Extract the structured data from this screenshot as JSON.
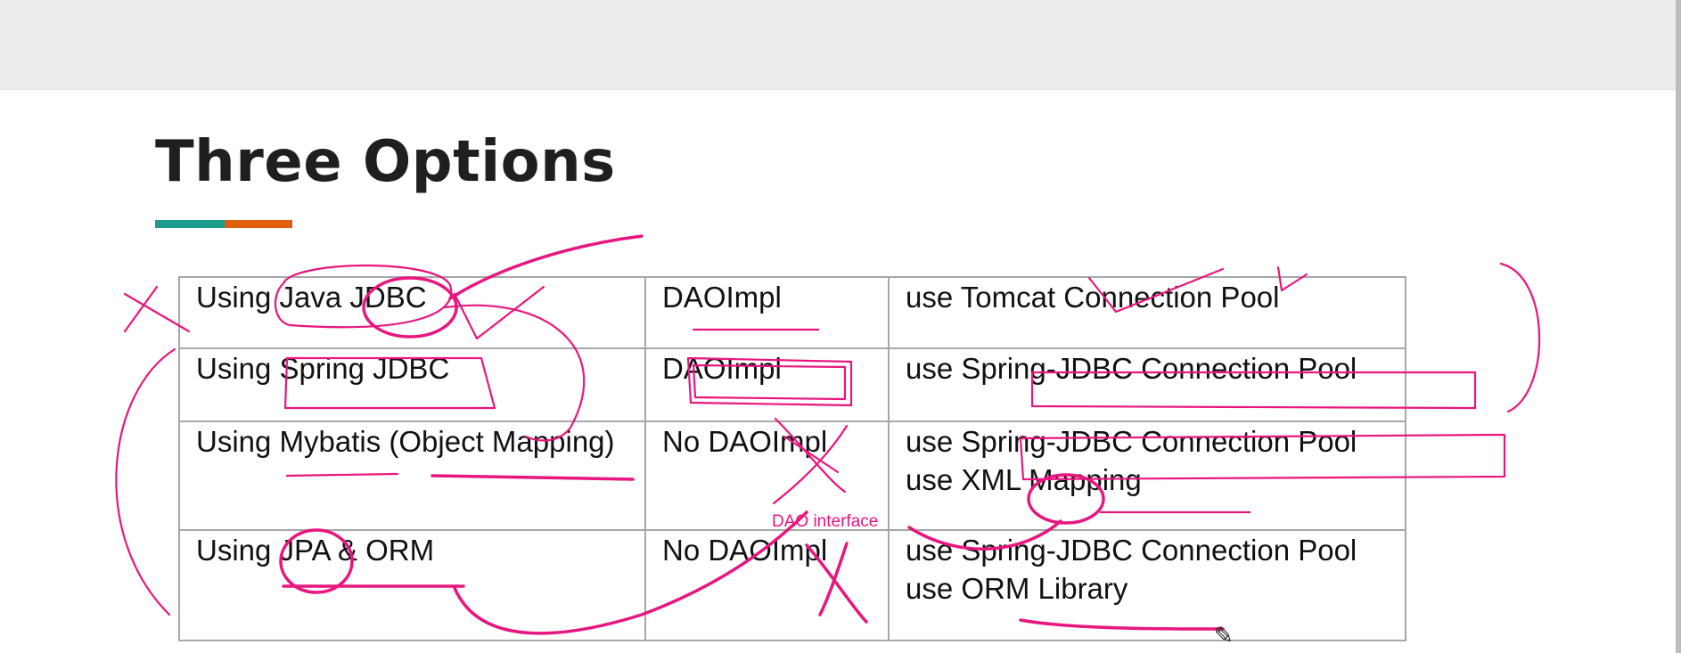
{
  "slide": {
    "title": "Three Options",
    "accent_colors": [
      "#1a9d8b",
      "#e25d0e"
    ]
  },
  "table": {
    "rows": [
      {
        "approach": [
          "Using Java JDBC"
        ],
        "dao": "DAOImpl",
        "notes": [
          "use Tomcat Connection Pool"
        ]
      },
      {
        "approach": [
          "Using Spring JDBC"
        ],
        "dao": "DAOImpl",
        "notes": [
          "use Spring-JDBC Connection Pool"
        ]
      },
      {
        "approach": [
          "Using Mybatis (Object Mapping)"
        ],
        "dao": "No DAOImpl",
        "notes": [
          "use Spring-JDBC Connection Pool",
          "use XML Mapping"
        ]
      },
      {
        "approach": [
          "Using JPA & ORM"
        ],
        "dao": "No DAOImpl",
        "notes": [
          "use Spring-JDBC Connection Pool",
          "use ORM Library"
        ]
      }
    ],
    "border_color": "#a7a7a7"
  },
  "annotations": {
    "ink_color": "#e8167f",
    "handwritten_label": "DAO interface"
  },
  "icons": {
    "cursor": "pen-cursor-icon"
  }
}
